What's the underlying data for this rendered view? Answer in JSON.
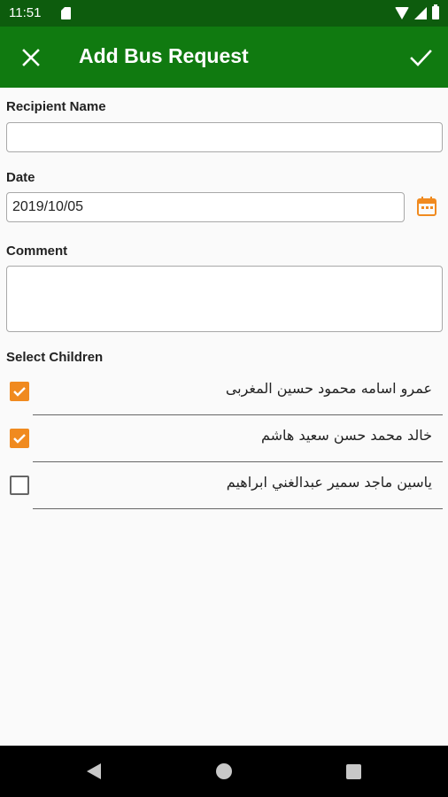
{
  "status_bar": {
    "time": "11:51",
    "icons": [
      "sd-card-icon",
      "wifi-icon",
      "signal-icon",
      "battery-icon"
    ]
  },
  "app_bar": {
    "title": "Add Bus Request",
    "close_icon": "close-icon",
    "confirm_icon": "check-icon",
    "background": "#107a10"
  },
  "form": {
    "recipient_label": "Recipient Name",
    "recipient_value": "",
    "date_label": "Date",
    "date_value": "2019/10/05",
    "comment_label": "Comment",
    "comment_value": "",
    "children_label": "Select Children",
    "accent_color": "#f08a1f"
  },
  "children": [
    {
      "name": "عمرو اسامه محمود حسين المغربى",
      "checked": true
    },
    {
      "name": "خالد محمد حسن سعيد هاشم",
      "checked": true
    },
    {
      "name": "ياسين ماجد سمير عبدالغني ابراهيم",
      "checked": false
    }
  ],
  "nav_bar": {
    "icons": [
      "back-icon",
      "home-icon",
      "recents-icon"
    ]
  }
}
